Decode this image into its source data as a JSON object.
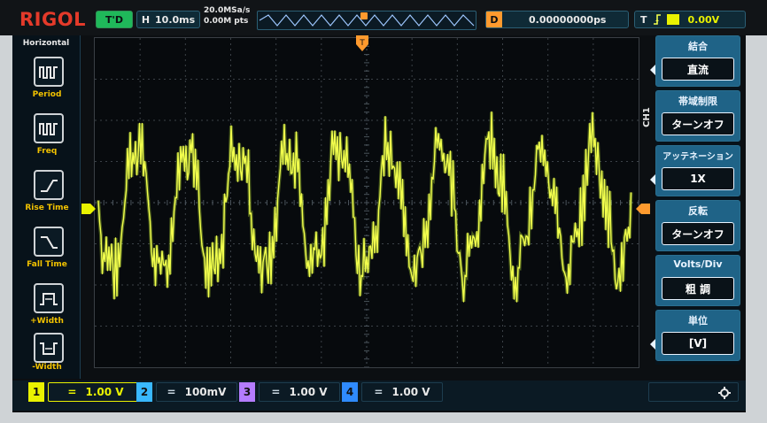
{
  "brand": "RIGOL",
  "header": {
    "trigger_status": "T'D",
    "h_label": "H",
    "timebase": "10.0ms",
    "sample_rate": "20.0MSa/s",
    "memory_depth": "0.00M pts",
    "d_label": "D",
    "delay": "0.00000000ps",
    "t_label": "T",
    "trigger_level": "0.00V"
  },
  "left_menu": {
    "title": "Horizontal",
    "items": [
      {
        "label": "Period",
        "icon": "period-icon"
      },
      {
        "label": "Freq",
        "icon": "frequency-icon"
      },
      {
        "label": "Rise Time",
        "icon": "rise-time-icon"
      },
      {
        "label": "Fall Time",
        "icon": "fall-time-icon"
      },
      {
        "label": "+Width",
        "icon": "positive-width-icon"
      },
      {
        "label": "-Width",
        "icon": "negative-width-icon"
      }
    ]
  },
  "right_menu": {
    "channel_tag": "CH1",
    "items": [
      {
        "title": "結合",
        "value": "直流"
      },
      {
        "title": "帯域制限",
        "value": "ターンオフ"
      },
      {
        "title": "アッテネーション",
        "value": "1X"
      },
      {
        "title": "反転",
        "value": "ターンオフ"
      },
      {
        "title": "Volts/Div",
        "value": "粗 調"
      },
      {
        "title": "単位",
        "value": "[V]"
      }
    ]
  },
  "channels": [
    {
      "number": "1",
      "value": "1.00 V",
      "color": "#e9f200",
      "active": true
    },
    {
      "number": "2",
      "value": "100mV",
      "color": "#39b8ff",
      "active": false
    },
    {
      "number": "3",
      "value": "1.00 V",
      "color": "#b47cff",
      "active": false
    },
    {
      "number": "4",
      "value": "1.00 V",
      "color": "#2f8bff",
      "active": false
    }
  ],
  "colors": {
    "trace": "#c8f53a",
    "trace_core": "#f2ff4d",
    "grid": "#3b4147",
    "grid_major": "#4a535b",
    "brand_red": "#e43a2a",
    "accent_blue": "#1f6387",
    "text_yellow": "#f2c200"
  }
}
